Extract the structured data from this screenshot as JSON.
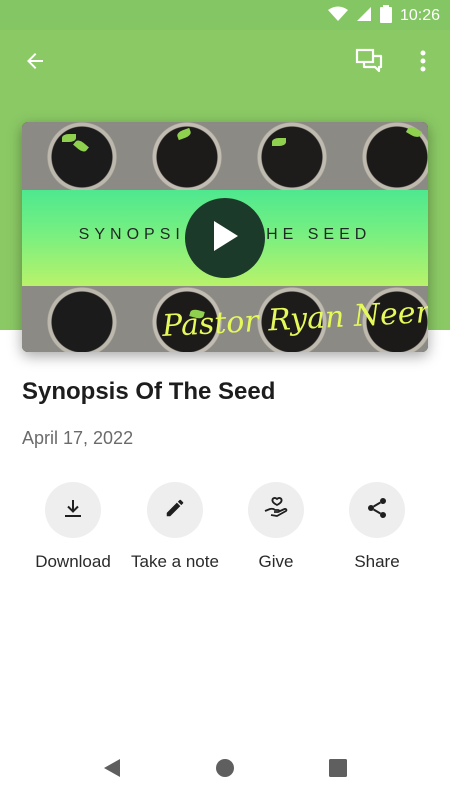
{
  "status_bar": {
    "time": "10:26"
  },
  "hero": {
    "title_text": "SYNOPSIS OF THE SEED",
    "signature": "Pastor Ryan Neer"
  },
  "content": {
    "title": "Synopsis Of The Seed",
    "date": "April 17, 2022"
  },
  "actions": [
    {
      "label": "Download",
      "icon": "download-icon"
    },
    {
      "label": "Take a note",
      "icon": "pencil-icon"
    },
    {
      "label": "Give",
      "icon": "give-hand-heart-icon"
    },
    {
      "label": "Share",
      "icon": "share-icon"
    }
  ],
  "colors": {
    "header_green": "#8bc965",
    "status_green": "#85c664",
    "band_gradient_start": "#4ee88f",
    "band_gradient_end": "#b9f26a",
    "signature_yellow": "#e6f95a",
    "action_circle_bg": "#eeeeee"
  }
}
